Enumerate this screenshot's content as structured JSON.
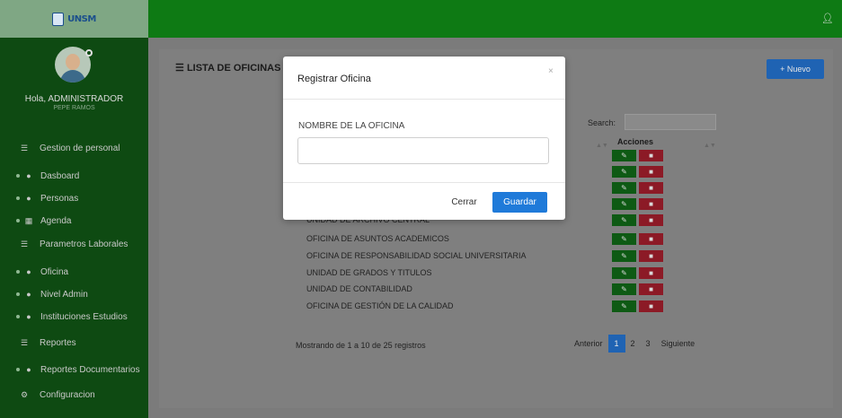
{
  "header": {
    "logo_text": "UNSM"
  },
  "sidebar": {
    "greeting": "Hola, ADMINISTRADOR",
    "username": "PEPE RAMOS",
    "items": [
      {
        "label": "Gestion de personal",
        "icon": "list-icon",
        "type": "section"
      },
      {
        "label": "Dasboard",
        "icon": "user-icon",
        "type": "sub"
      },
      {
        "label": "Personas",
        "icon": "user-icon",
        "type": "sub"
      },
      {
        "label": "Agenda",
        "icon": "calendar-icon",
        "type": "sub"
      },
      {
        "label": "Parametros Laborales",
        "icon": "list-icon",
        "type": "section"
      },
      {
        "label": "Oficina",
        "icon": "user-icon",
        "type": "sub"
      },
      {
        "label": "Nivel Admin",
        "icon": "user-icon",
        "type": "sub"
      },
      {
        "label": "Instituciones Estudios",
        "icon": "user-icon",
        "type": "sub"
      },
      {
        "label": "Reportes",
        "icon": "list-icon",
        "type": "section"
      },
      {
        "label": "Reportes Documentarios",
        "icon": "user-icon",
        "type": "sub"
      },
      {
        "label": "Configuracion",
        "icon": "gear-icon",
        "type": "section"
      }
    ]
  },
  "main": {
    "title": "LISTA DE OFICINAS",
    "new_button": "+ Nuevo",
    "search_label": "Search:",
    "column_actions": "Acciones",
    "rows": [
      "UNIDAD DE ARCHIVO CENTRAL",
      "OFICINA DE ASUNTOS ACADEMICOS",
      "OFICINA DE RESPONSABILIDAD SOCIAL UNIVERSITARIA",
      "UNIDAD DE GRADOS Y TITULOS",
      "UNIDAD DE CONTABILIDAD",
      "OFICINA DE GESTIÓN DE LA CALIDAD"
    ],
    "info": "Mostrando de 1 a 10 de 25 registros",
    "pagination": {
      "prev": "Anterior",
      "pages": [
        "1",
        "2",
        "3"
      ],
      "next": "Siguiente"
    }
  },
  "modal": {
    "title": "Registrar Oficina",
    "close_symbol": "×",
    "field_label": "NOMBRE DE LA OFICINA",
    "field_value": "",
    "cancel_button": "Cerrar",
    "save_button": "Guardar"
  },
  "colors": {
    "brand_green": "#0e7a14",
    "sidebar_green": "#0e4a12",
    "primary_blue": "#1f7ad9",
    "danger_red": "#8c1a26"
  }
}
